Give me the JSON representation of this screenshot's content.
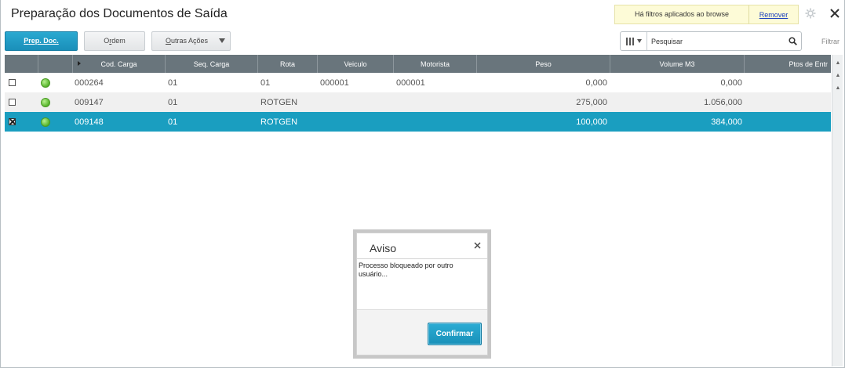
{
  "window": {
    "title": "Preparação dos Documentos de Saída",
    "filter_notice": "Há filtros aplicados ao browse",
    "remove_label": "Remover"
  },
  "toolbar": {
    "prep_label_u": "P",
    "prep_label_rest": "rep. Doc.",
    "ordem_label_pre": "O",
    "ordem_label_u": "r",
    "ordem_label_rest": "dem",
    "outras_label_u": "O",
    "outras_label_rest": "utras Ações"
  },
  "search": {
    "placeholder": "Pesquisar",
    "filter_label": "Filtrar"
  },
  "grid": {
    "columns": [
      "Cod. Carga",
      "Seq. Carga",
      "Rota",
      "Veiculo",
      "Motorista",
      "Peso",
      "Volume M3",
      "Ptos de Entr"
    ],
    "rows": [
      {
        "checked": false,
        "cod_carga": "000264",
        "seq_carga": "01",
        "rota": "01",
        "veiculo": "000001",
        "motorista": "000001",
        "peso": "0,000",
        "volume": "0,000",
        "ptos": ""
      },
      {
        "checked": false,
        "cod_carga": "009147",
        "seq_carga": "01",
        "rota": "ROTGEN",
        "veiculo": "",
        "motorista": "",
        "peso": "275,000",
        "volume": "1.056,000",
        "ptos": ""
      },
      {
        "checked": true,
        "cod_carga": "009148",
        "seq_carga": "01",
        "rota": "ROTGEN",
        "veiculo": "",
        "motorista": "",
        "peso": "100,000",
        "volume": "384,000",
        "ptos": ""
      }
    ]
  },
  "dialog": {
    "title": "Aviso",
    "message": "Processo bloqueado por outro usuário...",
    "confirm_label": "Confirmar"
  },
  "colors": {
    "accent": "#1a9ec0",
    "header_bg": "#69757c",
    "status_led": "#57b52b"
  },
  "icons": {
    "close": "close-icon",
    "settings": "gear-icon",
    "search": "search-icon",
    "columns": "columns-icon"
  }
}
